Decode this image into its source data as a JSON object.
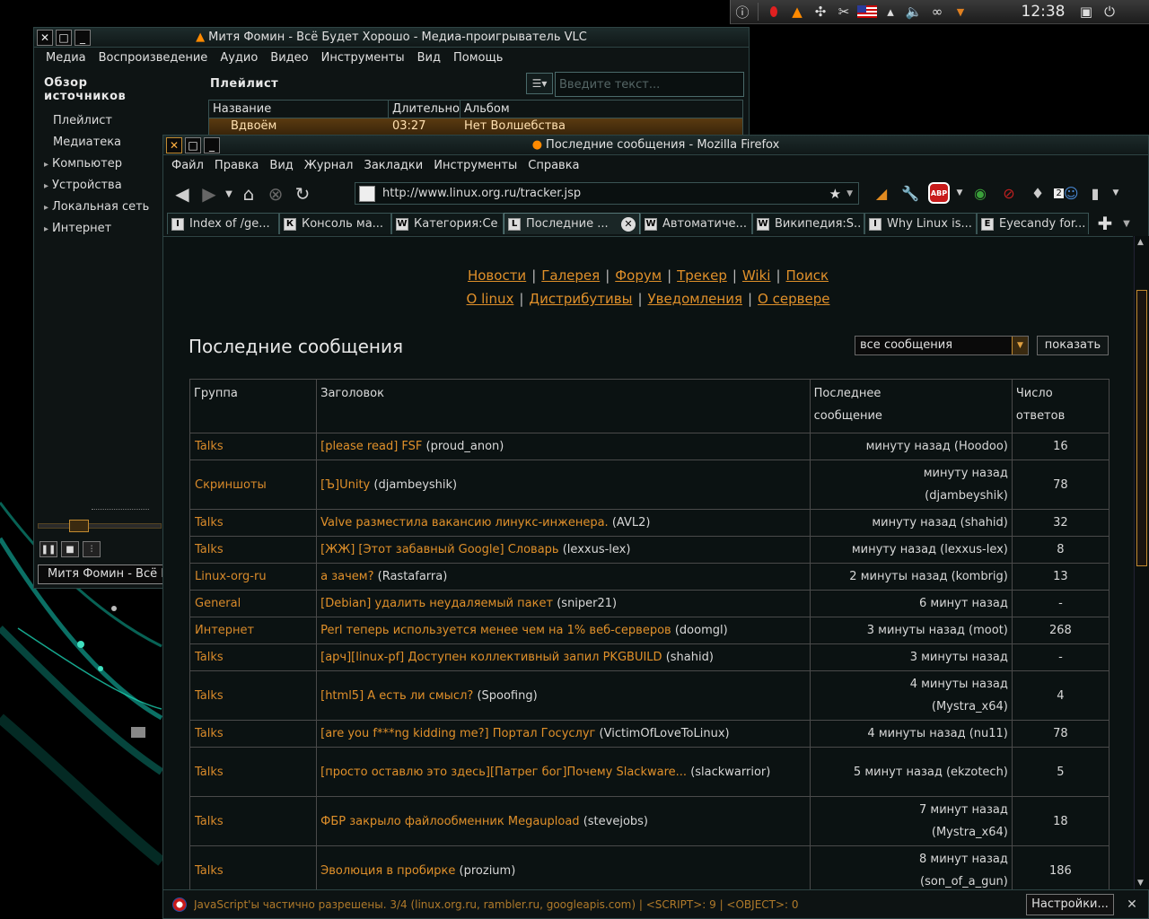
{
  "tray": {
    "clock": "12:38",
    "icons": [
      "info-icon",
      "opera-icon",
      "vlc-cone-icon",
      "network-icon",
      "tools-icon",
      "flag-us-icon",
      "cleaner-icon",
      "volume-icon",
      "link-icon",
      "dropdown-icon"
    ]
  },
  "vlc": {
    "title": "Митя Фомин - Всё Будет Хорошо - Медиа-проигрыватель VLC",
    "menu": [
      "Медиа",
      "Воспроизведение",
      "Аудио",
      "Видео",
      "Инструменты",
      "Вид",
      "Помощь"
    ],
    "sidebar": {
      "heading": "Обзор источников",
      "items": [
        "Плейлист",
        "Медиатека"
      ],
      "expandable": [
        "Компьютер",
        "Устройства",
        "Локальная сеть",
        "Интернет"
      ]
    },
    "playlist_heading": "Плейлист",
    "search_placeholder": "Введите текст...",
    "columns": [
      "Название",
      "Длительность",
      "Альбом"
    ],
    "row": {
      "title": "Вдвоём",
      "duration": "03:27",
      "album": "Нет Волшебства"
    },
    "status_text": "Митя Фомин - Всё Будет Хорошо"
  },
  "firefox": {
    "title": "Последние сообщения - Mozilla Firefox",
    "menu": [
      "Файл",
      "Правка",
      "Вид",
      "Журнал",
      "Закладки",
      "Инструменты",
      "Справка"
    ],
    "url": "http://www.linux.org.ru/tracker.jsp",
    "abp_label": "ABP",
    "badge_count": "2",
    "tabs": [
      {
        "label": "Index of /ge...",
        "icon": "I"
      },
      {
        "label": "Консоль ма...",
        "icon": "К"
      },
      {
        "label": "Категория:Се...",
        "icon": "W"
      },
      {
        "label": "Последние ...",
        "icon": "L",
        "active": true
      },
      {
        "label": "Автоматиче...",
        "icon": "W"
      },
      {
        "label": "Википедия:S...",
        "icon": "W"
      },
      {
        "label": "Why Linux is...",
        "icon": "I"
      },
      {
        "label": "Eyecandy for...",
        "icon": "E"
      }
    ],
    "statusbar": {
      "text": "JavaScript'ы частично разрешены. 3/4 (linux.org.ru, rambler.ru, googleapis.com) | <SCRIPT>: 9 | <OBJECT>: 0",
      "settings_label": "Настройки..."
    }
  },
  "page": {
    "nav_row1": [
      "Новости",
      "Галерея",
      "Форум",
      "Трекер",
      "Wiki",
      "Поиск"
    ],
    "nav_row2": [
      "О linux",
      "Дистрибутивы",
      "Уведомления",
      "О сервере"
    ],
    "title": "Последние сообщения",
    "filter_value": "все сообщения",
    "show_label": "показать",
    "table_headers": {
      "group": "Группа",
      "title": "Заголовок",
      "last_line1": "Последнее",
      "last_line2": "сообщение",
      "count_line1": "Число",
      "count_line2": "ответов"
    },
    "rows": [
      {
        "group": "Talks",
        "title": "[please read] FSF",
        "author": "(proud_anon)",
        "last1": "минуту назад (Hoodoo)",
        "last2": "",
        "count": "16"
      },
      {
        "group": "Скриншоты",
        "title": "[Ъ]Unity",
        "author": "(djambeyshik)",
        "last1": "минуту назад",
        "last2": "(djambeyshik)",
        "count": "78"
      },
      {
        "group": "Talks",
        "title": "Valve разместила вакансию линукс-инженера.",
        "author": "(AVL2)",
        "last1": "минуту назад (shahid)",
        "last2": "",
        "count": "32"
      },
      {
        "group": "Talks",
        "title": "[ЖЖ] [Этот забавный Google] Словарь",
        "author": "(lexxus-lex)",
        "last1": "минуту назад (lexxus-lex)",
        "last2": "",
        "count": "8"
      },
      {
        "group": "Linux-org-ru",
        "title": "а зачем?",
        "author": "(Rastafarra)",
        "last1": "2 минуты назад (kombrig)",
        "last2": "",
        "count": "13"
      },
      {
        "group": "General",
        "title": "[Debian] удалить неудаляемый пакет",
        "author": "(sniper21)",
        "last1": "6 минут назад",
        "last2": "",
        "count": "-"
      },
      {
        "group": "Интернет",
        "title": "Perl теперь используется менее чем на 1% веб-серверов",
        "author": "(doomgl)",
        "last1": "3 минуты назад (moot)",
        "last2": "",
        "count": "268"
      },
      {
        "group": "Talks",
        "title": "[арч][linux-pf] Доступен коллективный запил PKGBUILD",
        "author": "(shahid)",
        "last1": "3 минуты назад",
        "last2": "",
        "count": "-"
      },
      {
        "group": "Talks",
        "title": "[html5] А есть ли смысл?",
        "author": "(Spoofing)",
        "last1": "4 минуты назад",
        "last2": "(Mystra_x64)",
        "count": "4"
      },
      {
        "group": "Talks",
        "title": "[are you f***ng kidding me?] Портал Госуслуг",
        "author": "(VictimOfLoveToLinux)",
        "last1": "4 минуты назад (nu11)",
        "last2": "",
        "count": "78"
      },
      {
        "group": "Talks",
        "title": "[просто оставлю это здесь][Патрег бог]Почему Slackware...",
        "author": "(slackwarrior)",
        "last1": "5 минут назад (ekzotech)",
        "last2": "",
        "count": "5"
      },
      {
        "group": "Talks",
        "title": "ФБР закрыло файлообменник Megaupload",
        "author": "(stevejobs)",
        "last1": "7 минут назад",
        "last2": "(Mystra_x64)",
        "count": "18"
      },
      {
        "group": "Talks",
        "title": "Эволюция в пробирке",
        "author": "(prozium)",
        "last1": "8 минут назад",
        "last2": "(son_of_a_gun)",
        "count": "186"
      }
    ]
  }
}
